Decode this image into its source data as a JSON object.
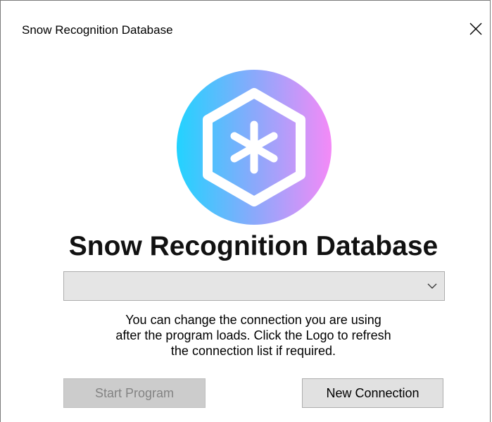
{
  "window": {
    "title": "Snow Recognition Database",
    "close_icon": "close-icon"
  },
  "logo": {
    "icon": "snowflake-hexagon-logo",
    "gradient": [
      "#22d3ff",
      "#f48af7"
    ]
  },
  "app_title": "Snow Recognition Database",
  "connection_select": {
    "value": "",
    "icon": "chevron-down-icon"
  },
  "info": {
    "lines": [
      "You can change the connection you are using",
      "after the program loads. Click the Logo to refresh",
      "the connection list if required."
    ]
  },
  "buttons": {
    "start_label": "Start Program",
    "new_connection_label": "New Connection"
  }
}
